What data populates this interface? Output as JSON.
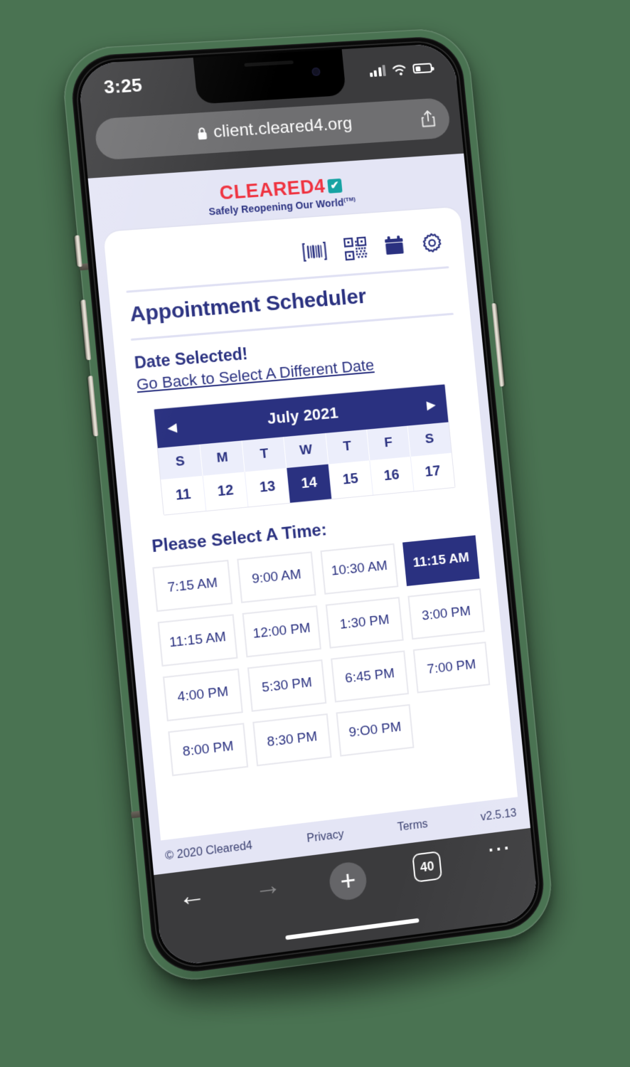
{
  "device": {
    "status_bar": {
      "time": "3:25",
      "signal_icon": "cellular-bars-icon",
      "wifi_icon": "wifi-icon",
      "battery_icon": "battery-icon"
    },
    "browser_top": {
      "lock_icon": "lock-icon",
      "url": "client.cleared4.org",
      "share_icon": "share-icon"
    },
    "browser_bottom": {
      "back_icon": "arrow-left-icon",
      "forward_icon": "arrow-right-icon",
      "new_tab_label": "+",
      "tab_count": "40",
      "menu_icon": "more-dots-icon"
    }
  },
  "brand": {
    "wordmark": "CLEARED4",
    "check_glyph": "✔",
    "tagline": "Safely Reopening Our World",
    "tagline_tm": "(TM)"
  },
  "toolbar": {
    "icons": [
      {
        "name": "barcode-icon",
        "label": "Barcode"
      },
      {
        "name": "qr-code-icon",
        "label": "QR Code"
      },
      {
        "name": "calendar-icon",
        "label": "Calendar"
      },
      {
        "name": "gear-icon",
        "label": "Settings"
      }
    ]
  },
  "main": {
    "page_title": "Appointment Scheduler",
    "date_selected_heading": "Date Selected!",
    "go_back_link": "Go Back to Select A Different Date",
    "select_time_heading": "Please Select A Time:"
  },
  "calendar": {
    "month_label": "July 2021",
    "prev_glyph": "◀",
    "next_glyph": "▶",
    "day_headers": [
      "S",
      "M",
      "T",
      "W",
      "T",
      "F",
      "S"
    ],
    "days": [
      {
        "label": "11",
        "selected": false
      },
      {
        "label": "12",
        "selected": false
      },
      {
        "label": "13",
        "selected": false
      },
      {
        "label": "14",
        "selected": true
      },
      {
        "label": "15",
        "selected": false
      },
      {
        "label": "16",
        "selected": false
      },
      {
        "label": "17",
        "selected": false
      }
    ]
  },
  "time_slots": [
    {
      "label": "7:15 AM",
      "selected": false
    },
    {
      "label": "9:00 AM",
      "selected": false
    },
    {
      "label": "10:30 AM",
      "selected": false
    },
    {
      "label": "11:15 AM",
      "selected": true
    },
    {
      "label": "11:15 AM",
      "selected": false
    },
    {
      "label": "12:00 PM",
      "selected": false
    },
    {
      "label": "1:30 PM",
      "selected": false
    },
    {
      "label": "3:00 PM",
      "selected": false
    },
    {
      "label": "4:00 PM",
      "selected": false
    },
    {
      "label": "5:30 PM",
      "selected": false
    },
    {
      "label": "6:45 PM",
      "selected": false
    },
    {
      "label": "7:00 PM",
      "selected": false
    },
    {
      "label": "8:00 PM",
      "selected": false
    },
    {
      "label": "8:30 PM",
      "selected": false
    },
    {
      "label": "9:O0 PM",
      "selected": false
    }
  ],
  "footer": {
    "copyright": "© 2020 Cleared4",
    "privacy": "Privacy",
    "terms": "Terms",
    "version": "v2.5.13"
  },
  "colors": {
    "background_green": "#4a7352",
    "navy": "#2a3180",
    "brand_red": "#ef3340",
    "brand_teal": "#17a3a3",
    "page_lavender": "#e4e5f5"
  }
}
